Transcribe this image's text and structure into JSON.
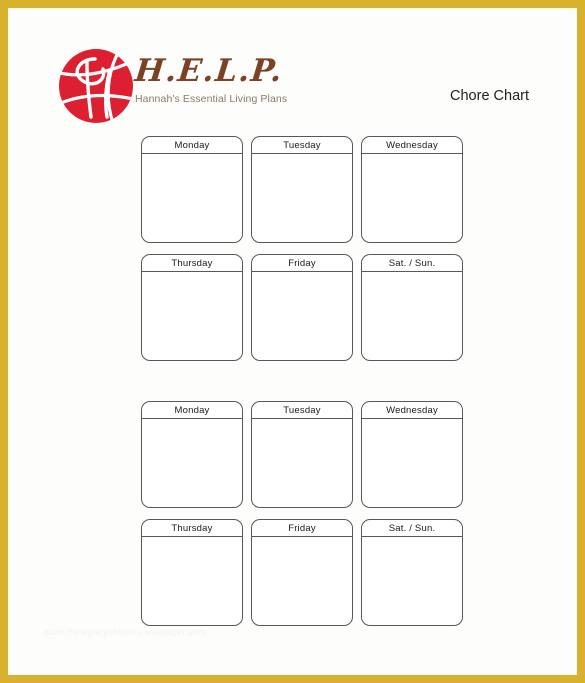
{
  "page": {
    "border_color": "#d8b22e",
    "background_color": "#fdfdfb"
  },
  "header": {
    "logo": {
      "icon": "help-basketball-logo",
      "circle_color": "#dc2031",
      "brand_word": "H.E.L.P.",
      "brand_word_color": "#7b4226",
      "tagline": "Hannah's Essential Living Plans",
      "tagline_color": "#8a7b6e"
    },
    "title": "Chore Chart"
  },
  "sections": [
    {
      "name": "chore-chart-week-1",
      "rows": [
        {
          "days": [
            {
              "label": "Monday"
            },
            {
              "label": "Tuesday"
            },
            {
              "label": "Wednesday"
            }
          ]
        },
        {
          "days": [
            {
              "label": "Thursday"
            },
            {
              "label": "Friday"
            },
            {
              "label": "Sat. / Sun."
            }
          ]
        }
      ]
    },
    {
      "name": "chore-chart-week-2",
      "rows": [
        {
          "days": [
            {
              "label": "Monday"
            },
            {
              "label": "Tuesday"
            },
            {
              "label": "Wednesday"
            }
          ]
        },
        {
          "days": [
            {
              "label": "Thursday"
            },
            {
              "label": "Friday"
            },
            {
              "label": "Sat. / Sun."
            }
          ]
        }
      ]
    }
  ],
  "watermark": {
    "text": "www.thelegacyofmoms.wallpaper.com"
  }
}
